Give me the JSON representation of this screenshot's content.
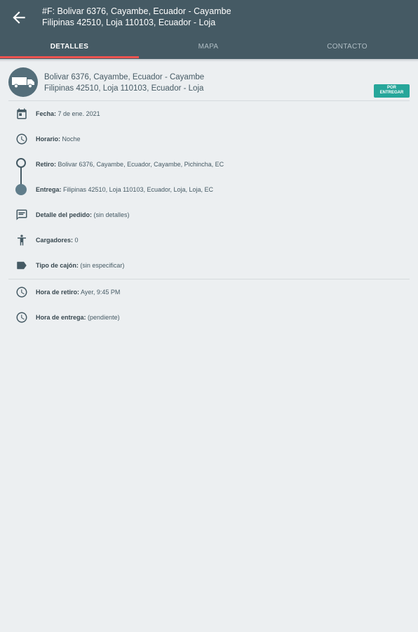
{
  "appbar": {
    "title_line1": "#F: Bolivar 6376, Cayambe, Ecuador - Cayambe",
    "title_line2": "Filipinas 42510, Loja 110103, Ecuador - Loja"
  },
  "tabs": [
    {
      "label": "DETALLES",
      "active": true
    },
    {
      "label": "MAPA",
      "active": false
    },
    {
      "label": "CONTACTO",
      "active": false
    }
  ],
  "header": {
    "line1": "Bolivar 6376, Cayambe, Ecuador - Cayambe",
    "line2": "Filipinas 42510, Loja 110103, Ecuador - Loja",
    "badge_line1": "POR",
    "badge_line2": "ENTREGAR"
  },
  "details": {
    "fecha_label": "Fecha:",
    "fecha_value": "7 de ene. 2021",
    "horario_label": "Horario:",
    "horario_value": "Noche",
    "retiro_label": "Retiro:",
    "retiro_value": "Bolivar 6376, Cayambe, Ecuador, Cayambe, Pichincha, EC",
    "entrega_label": "Entrega:",
    "entrega_value": "Filipinas 42510, Loja 110103, Ecuador, Loja, Loja, EC",
    "detalle_label": "Detalle del pedido:",
    "detalle_value": "(sin detalles)",
    "cargadores_label": "Cargadores:",
    "cargadores_value": "0",
    "cajon_label": "Tipo de cajón:",
    "cajon_value": "(sin especificar)",
    "hora_retiro_label": "Hora de retiro:",
    "hora_retiro_value": "Ayer, 9:45 PM",
    "hora_entrega_label": "Hora de entrega:",
    "hora_entrega_value": "(pendiente)"
  },
  "colors": {
    "appbar": "#455a64",
    "tab_indicator": "#ef5350",
    "badge": "#26a69a",
    "background": "#eceff1"
  },
  "icons": [
    "back-arrow-icon",
    "truck-icon",
    "calendar-icon",
    "clock-icon",
    "chat-icon",
    "person-icon",
    "label-icon"
  ]
}
